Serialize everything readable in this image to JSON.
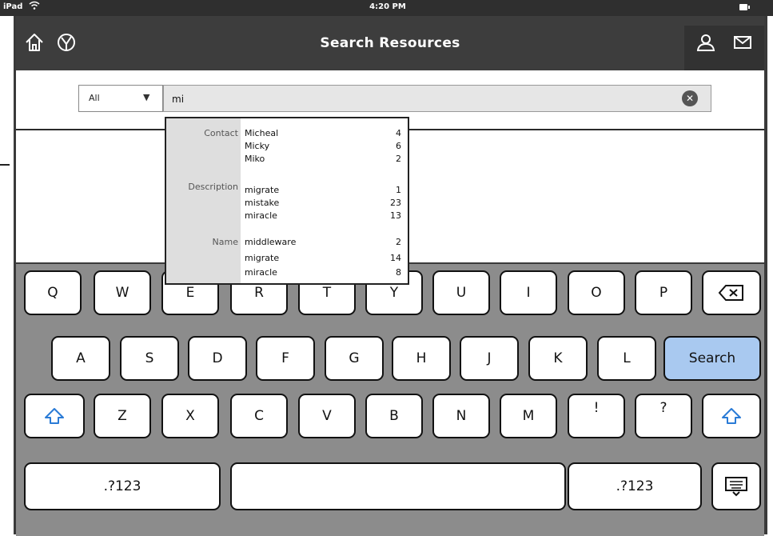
{
  "status_bar": {
    "carrier": "iPad",
    "time": "4:20 PM"
  },
  "nav": {
    "title": "Search Resources"
  },
  "search": {
    "scope": "All",
    "query": "mi"
  },
  "dropdown": [
    {
      "label": "Contact",
      "items": [
        {
          "term": "Micheal",
          "count": "4"
        },
        {
          "term": "Micky",
          "count": "6"
        },
        {
          "term": "Miko",
          "count": "2"
        }
      ]
    },
    {
      "label": "Description",
      "items": [
        {
          "term": "migrate",
          "count": "1"
        },
        {
          "term": "mistake",
          "count": "23"
        },
        {
          "term": "miracle",
          "count": "13"
        }
      ]
    },
    {
      "label": "Name",
      "items": [
        {
          "term": "middleware",
          "count": "2"
        },
        {
          "term": "migrate",
          "count": "14"
        },
        {
          "term": "miracle",
          "count": "8"
        }
      ]
    }
  ],
  "keyboard": {
    "row1": [
      "Q",
      "W",
      "E",
      "R",
      "T",
      "Y",
      "U",
      "I",
      "O",
      "P"
    ],
    "row2": [
      "A",
      "S",
      "D",
      "F",
      "G",
      "H",
      "J",
      "K",
      "L"
    ],
    "search_label": "Search",
    "row3": [
      "Z",
      "X",
      "C",
      "V",
      "B",
      "N",
      "M",
      "!",
      "?"
    ],
    "numbers_left": ".?123",
    "numbers_right": ".?123"
  },
  "icons": {
    "home": "home-icon",
    "logo": "logo-icon",
    "user": "user-icon",
    "mail": "mail-icon",
    "clear": "clear-icon",
    "backspace": "backspace-icon",
    "shift": "shift-icon",
    "hide_keyboard": "hide-keyboard-icon",
    "wifi": "wifi-icon",
    "battery": "battery-icon"
  },
  "colors": {
    "search_key": "#a9c9f0",
    "navbar": "#3d3d3d",
    "keyboard": "#8c8c8c"
  }
}
